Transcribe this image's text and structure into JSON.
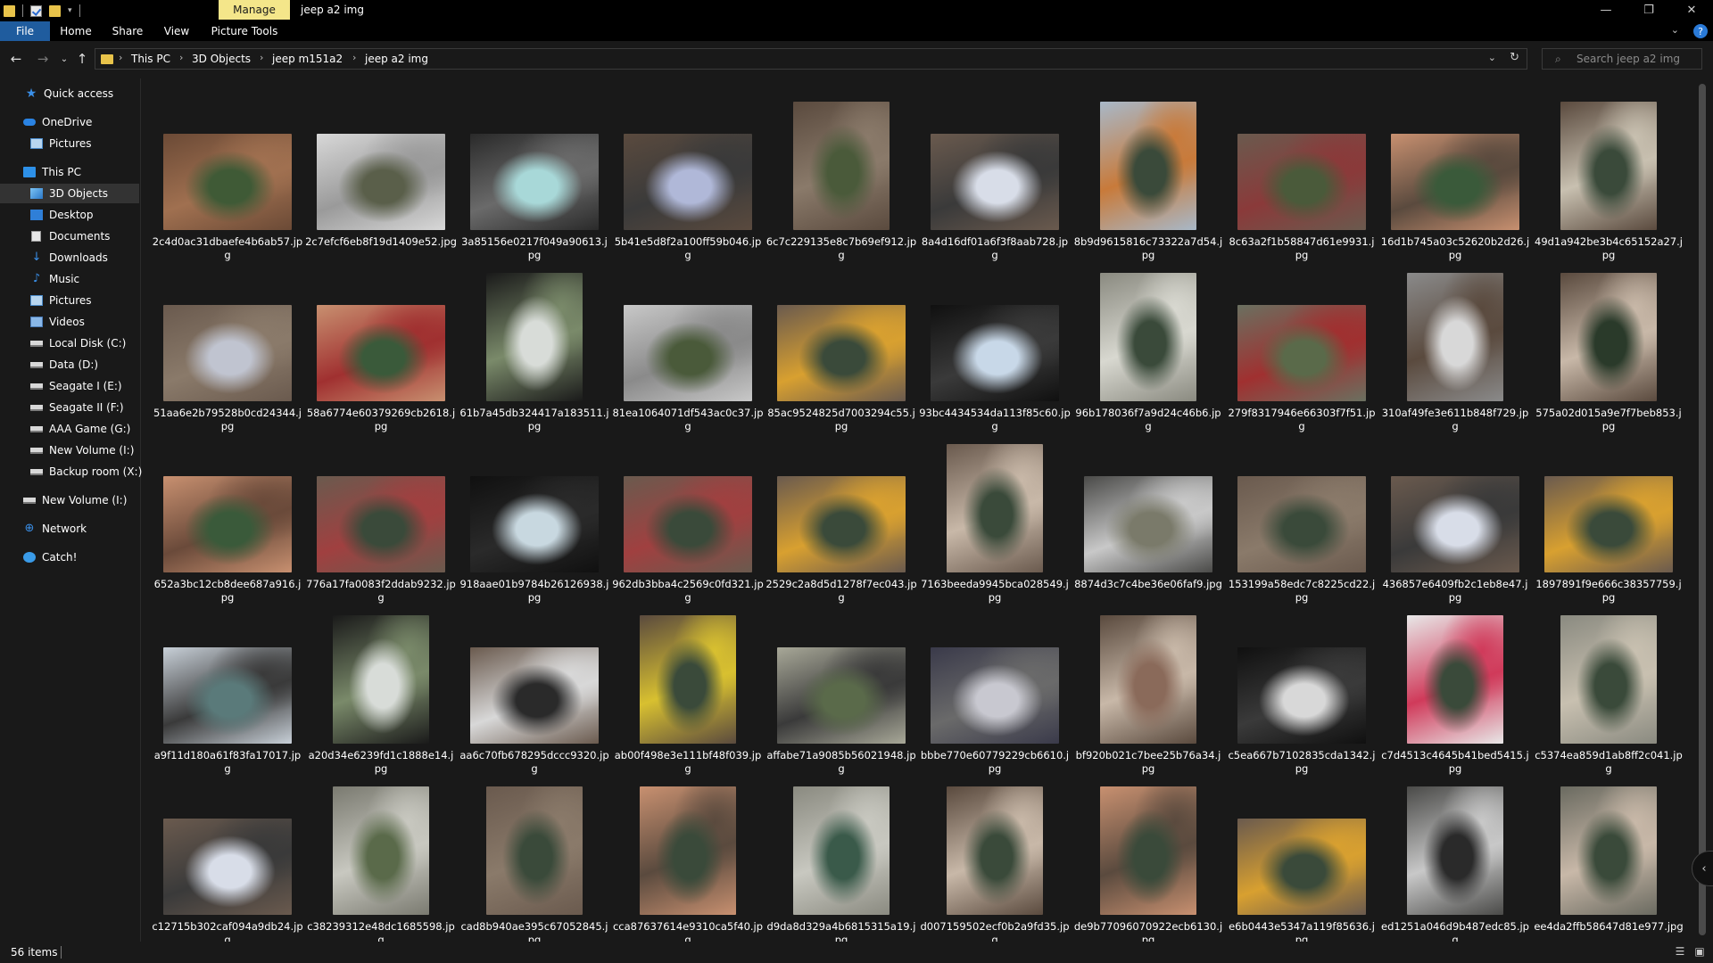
{
  "window": {
    "title": "jeep a2 img",
    "manage_tab": "Manage",
    "controls": {
      "minimize": "—",
      "restore": "❐",
      "close": "✕"
    }
  },
  "ribbon": {
    "tabs": [
      "File",
      "Home",
      "Share",
      "View",
      "Picture Tools"
    ],
    "help": "?"
  },
  "address_bar": {
    "breadcrumbs": [
      "This PC",
      "3D Objects",
      "jeep m151a2",
      "jeep a2 img"
    ],
    "search_placeholder": "Search jeep a2 img"
  },
  "sidebar": {
    "items": [
      {
        "label": "Quick access",
        "icon": "star-icon"
      },
      {
        "label": "OneDrive",
        "icon": "cloud-icon"
      },
      {
        "label": "Pictures",
        "icon": "pictures-icon"
      },
      {
        "label": "This PC",
        "icon": "computer-icon"
      },
      {
        "label": "3D Objects",
        "icon": "3d-objects-icon",
        "selected": true
      },
      {
        "label": "Desktop",
        "icon": "desktop-icon"
      },
      {
        "label": "Documents",
        "icon": "documents-icon"
      },
      {
        "label": "Downloads",
        "icon": "downloads-icon"
      },
      {
        "label": "Music",
        "icon": "music-icon"
      },
      {
        "label": "Pictures",
        "icon": "pictures-icon"
      },
      {
        "label": "Videos",
        "icon": "videos-icon"
      },
      {
        "label": "Local Disk (C:)",
        "icon": "drive-icon"
      },
      {
        "label": "Data (D:)",
        "icon": "drive-icon"
      },
      {
        "label": "Seagate I (E:)",
        "icon": "drive-icon"
      },
      {
        "label": "Seagate II (F:)",
        "icon": "drive-icon"
      },
      {
        "label": "AAA Game (G:)",
        "icon": "drive-icon"
      },
      {
        "label": "New Volume (I:)",
        "icon": "drive-icon"
      },
      {
        "label": "Backup room (X:)",
        "icon": "drive-icon"
      },
      {
        "label": "New Volume (I:)",
        "icon": "drive-icon"
      },
      {
        "label": "Network",
        "icon": "network-icon"
      },
      {
        "label": "Catch!",
        "icon": "catch-icon"
      }
    ]
  },
  "files": [
    {
      "name": "2c4d0ac31dbaefe4b6ab57.jpg",
      "orientation": "land",
      "colors": [
        "#6b4a36",
        "#3f5a36",
        "#a07050"
      ]
    },
    {
      "name": "2c7efcf6eb8f19d1409e52.jpg",
      "orientation": "land",
      "colors": [
        "#d8d8d8",
        "#5a5f4a",
        "#9a9a9a"
      ]
    },
    {
      "name": "3a85156e0217f049a90613.jpg",
      "orientation": "land",
      "colors": [
        "#2a2a2a",
        "#a8d8d8",
        "#6a6a6a"
      ]
    },
    {
      "name": "5b41e5d8f2a100ff59b046.jpg",
      "orientation": "land",
      "colors": [
        "#5a4a3e",
        "#b0b8d8",
        "#3a3a3a"
      ]
    },
    {
      "name": "6c7c229135e8c7b69ef912.jpg",
      "orientation": "port",
      "colors": [
        "#5a4a3e",
        "#4a5a3a",
        "#8a7a6a"
      ]
    },
    {
      "name": "8a4d16df01a6f3f8aab728.jpg",
      "orientation": "land",
      "colors": [
        "#6a5a4e",
        "#d8dde8",
        "#3a3a3a"
      ]
    },
    {
      "name": "8b9d9615816c73322a7d54.jpg",
      "orientation": "port",
      "colors": [
        "#a8b8c8",
        "#3a4a3a",
        "#c87a3a"
      ]
    },
    {
      "name": "8c63a2f1b58847d61e9931.jpg",
      "orientation": "land",
      "colors": [
        "#6a5a4e",
        "#4a5a3a",
        "#8a3a3a"
      ]
    },
    {
      "name": "16d1b745a03c52620b2d26.jpg",
      "orientation": "land",
      "colors": [
        "#c89070",
        "#3a5a3a",
        "#5a4a3e"
      ]
    },
    {
      "name": "49d1a942be3b4c65152a27.jpg",
      "orientation": "port",
      "colors": [
        "#5a4a3e",
        "#3a4a3a",
        "#c8c0b0"
      ]
    },
    {
      "name": "51aa6e2b79528b0cd24344.jpg",
      "orientation": "land",
      "colors": [
        "#6a5a4e",
        "#c0c4d0",
        "#8a7a6a"
      ]
    },
    {
      "name": "58a6774e60379269cb2618.jpg",
      "orientation": "land",
      "colors": [
        "#c89070",
        "#3a5a3a",
        "#a03030"
      ]
    },
    {
      "name": "61b7a45db324417a183511.jpg",
      "orientation": "port",
      "colors": [
        "#1a1a1a",
        "#d8dcd8",
        "#7a8a6a"
      ]
    },
    {
      "name": "81ea1064071df543ac0c37.jpg",
      "orientation": "land",
      "colors": [
        "#c8c8c8",
        "#4a5a3a",
        "#8a8a8a"
      ]
    },
    {
      "name": "85ac9524825d7003294c55.jpg",
      "orientation": "land",
      "colors": [
        "#6a5a4e",
        "#3a4a3a",
        "#d8a030"
      ]
    },
    {
      "name": "93bc4434534da113f85c60.jpg",
      "orientation": "land",
      "colors": [
        "#101010",
        "#c8d8e8",
        "#3a3a3a"
      ]
    },
    {
      "name": "96b178036f7a9d24c46b6.jpg",
      "orientation": "port",
      "colors": [
        "#8a8a80",
        "#3a4a3a",
        "#d8d8d0"
      ]
    },
    {
      "name": "279f8317946e66303f7f51.jpg",
      "orientation": "land",
      "colors": [
        "#6a7060",
        "#5a6a4a",
        "#a03030"
      ]
    },
    {
      "name": "310af49fe3e611b848f729.jpg",
      "orientation": "port",
      "colors": [
        "#8a8a8a",
        "#d8d8d8",
        "#5a4a3e"
      ]
    },
    {
      "name": "575a02d015a9e7f7beb853.jpg",
      "orientation": "port",
      "colors": [
        "#5a4a3e",
        "#2a3a2a",
        "#c8b8a8"
      ]
    },
    {
      "name": "652a3bc12cb8dee687a916.jpg",
      "orientation": "land",
      "colors": [
        "#c89070",
        "#3a5a3a",
        "#6a4a3a"
      ]
    },
    {
      "name": "776a17fa0083f2ddab9232.jpg",
      "orientation": "land",
      "colors": [
        "#6a5a4e",
        "#3a4a3a",
        "#a04040"
      ]
    },
    {
      "name": "918aae01b9784b26126938.jpg",
      "orientation": "land",
      "colors": [
        "#101010",
        "#c8d8e0",
        "#2a2a2a"
      ]
    },
    {
      "name": "962db3bba4c2569c0fd321.jpg",
      "orientation": "land",
      "colors": [
        "#6a5a4e",
        "#3a4a3a",
        "#a04040"
      ]
    },
    {
      "name": "2529c2a8d5d1278f7ec043.jpg",
      "orientation": "land",
      "colors": [
        "#6a5a4e",
        "#3a4a3a",
        "#d8a030"
      ]
    },
    {
      "name": "7163beeda9945bca028549.jpg",
      "orientation": "port",
      "colors": [
        "#6a5a4e",
        "#3a4a3a",
        "#c8b8a8"
      ]
    },
    {
      "name": "8874d3c7c4be36e06faf9.jpg",
      "orientation": "land",
      "colors": [
        "#4a4a48",
        "#7a7a6a",
        "#c8c8c8"
      ]
    },
    {
      "name": "153199a58edc7c8225cd22.jpg",
      "orientation": "land",
      "colors": [
        "#6a5a4e",
        "#3a4a3a",
        "#8a7a6a"
      ]
    },
    {
      "name": "436857e6409fb2c1eb8e47.jpg",
      "orientation": "land",
      "colors": [
        "#6a5a4e",
        "#d8dde8",
        "#3a3a3a"
      ]
    },
    {
      "name": "1897891f9e666c38357759.jpg",
      "orientation": "land",
      "colors": [
        "#6a5a4e",
        "#3a4a3a",
        "#d8a030"
      ]
    },
    {
      "name": "a9f11d180a61f83fa17017.jpg",
      "orientation": "land",
      "colors": [
        "#c8d0d8",
        "#5a7a7a",
        "#3a3a3a"
      ]
    },
    {
      "name": "a20d34e6239fd1c1888e14.jpg",
      "orientation": "port",
      "colors": [
        "#1a1a1a",
        "#d8dcd8",
        "#7a8a6a"
      ]
    },
    {
      "name": "aa6c70fb678295dccc9320.jpg",
      "orientation": "land",
      "colors": [
        "#6a5a4e",
        "#2a2a2a",
        "#d8d8d8"
      ]
    },
    {
      "name": "ab00f498e3e111bf48f039.jpg",
      "orientation": "port",
      "colors": [
        "#5a4a3e",
        "#3a4a3a",
        "#d8c030"
      ]
    },
    {
      "name": "affabe71a9085b56021948.jpg",
      "orientation": "land",
      "colors": [
        "#a8a898",
        "#5a6a4a",
        "#3a3a3a"
      ]
    },
    {
      "name": "bbbe770e60779229cb6610.jpg",
      "orientation": "land",
      "colors": [
        "#3a3a4a",
        "#c8c8d0",
        "#6a6a6a"
      ]
    },
    {
      "name": "bf920b021c7bee25b76a34.jpg",
      "orientation": "port",
      "colors": [
        "#5a4a3e",
        "#8a6a5a",
        "#c8b8a8"
      ]
    },
    {
      "name": "c5ea667b7102835cda1342.jpg",
      "orientation": "land",
      "colors": [
        "#101010",
        "#d8d8d8",
        "#3a3a3a"
      ]
    },
    {
      "name": "c7d4513c4645b41bed5415.jpg",
      "orientation": "port",
      "colors": [
        "#e8e8e8",
        "#3a4a3a",
        "#d03a5a"
      ]
    },
    {
      "name": "c5374ea859d1ab8ff2c041.jpg",
      "orientation": "port",
      "colors": [
        "#8a8a80",
        "#3a4a3a",
        "#c8c0b0"
      ]
    },
    {
      "name": "c12715b302caf094a9db24.jpg",
      "orientation": "land",
      "colors": [
        "#6a5a4e",
        "#d8dde8",
        "#3a3a3a"
      ]
    },
    {
      "name": "c38239312e48dc1685598.jpg",
      "orientation": "port",
      "colors": [
        "#7a7a70",
        "#5a6a4a",
        "#c8c8c0"
      ]
    },
    {
      "name": "cad8b940ae395c67052845.jpg",
      "orientation": "port",
      "colors": [
        "#6a5a4e",
        "#3a4a3a",
        "#8a7a6a"
      ]
    },
    {
      "name": "cca87637614e9310ca5f40.jpg",
      "orientation": "port",
      "colors": [
        "#c89070",
        "#3a4a3a",
        "#5a4a3e"
      ]
    },
    {
      "name": "d9da8d329a4b6815315a19.jpg",
      "orientation": "port",
      "colors": [
        "#8a8a80",
        "#3a5a4a",
        "#c8c8c0"
      ]
    },
    {
      "name": "d007159502ecf0b2a9fd35.jpg",
      "orientation": "port",
      "colors": [
        "#5a4a3e",
        "#3a4a3a",
        "#c8b8a8"
      ]
    },
    {
      "name": "de9b77096070922ecb6130.jpg",
      "orientation": "port",
      "colors": [
        "#c89070",
        "#3a4a3a",
        "#5a4a3e"
      ]
    },
    {
      "name": "e6b0443e5347a119f85636.jpg",
      "orientation": "land",
      "colors": [
        "#6a5a4e",
        "#3a4a3a",
        "#d8a030"
      ]
    },
    {
      "name": "ed1251a046d9b487edc85.jpg",
      "orientation": "port",
      "colors": [
        "#4a4a48",
        "#2a2a2a",
        "#c8c8c8"
      ]
    },
    {
      "name": "ee4da2ffb58647d81e977.jpg",
      "orientation": "port",
      "colors": [
        "#6a6a60",
        "#3a4a3a",
        "#c8b8a8"
      ]
    }
  ],
  "status": {
    "item_count": "56 items"
  }
}
